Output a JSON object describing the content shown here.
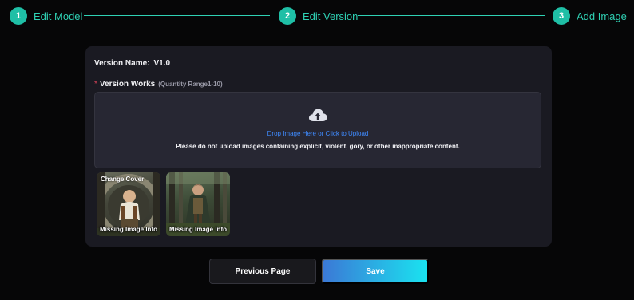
{
  "stepper": {
    "steps": [
      {
        "number": "1",
        "label": "Edit Model"
      },
      {
        "number": "2",
        "label": "Edit Version"
      },
      {
        "number": "3",
        "label": "Add Image"
      }
    ],
    "accent_color": "#1fbfa6"
  },
  "form": {
    "version_name_label": "Version Name:",
    "version_name_value": "V1.0",
    "required_mark": "*",
    "works_label": "Version Works",
    "works_range": "(Quantity Range1-10)",
    "dropzone": {
      "icon": "cloud-upload-icon",
      "cta": "Drop Image Here or Click to Upload",
      "warning": "Please do not upload images containing explicit, violent, gory, or other inappropriate content."
    },
    "images": [
      {
        "overlay_top": "Change Cover",
        "overlay_bottom": "Missing Image Info"
      },
      {
        "overlay_bottom": "Missing Image Info"
      }
    ]
  },
  "actions": {
    "previous_label": "Previous Page",
    "save_label": "Save",
    "save_gradient": [
      "#3b79d6",
      "#1ae3f0"
    ]
  }
}
